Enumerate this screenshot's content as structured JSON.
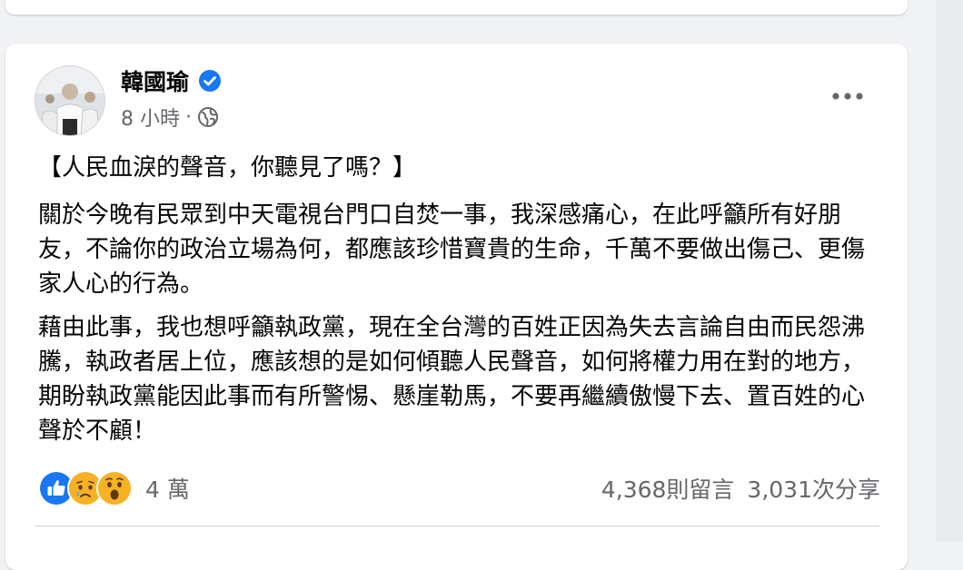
{
  "post": {
    "author": "韓國瑜",
    "time": "8 小時",
    "separator": "·",
    "title": "【人民血淚的聲音，你聽見了嗎？】",
    "paragraphs": [
      "關於今晚有民眾到中天電視台門口自焚一事，我深感痛心，在此呼籲所有好朋友，不論你的政治立場為何，都應該珍惜寶貴的生命，千萬不要做出傷己、更傷家人心的行為。",
      "藉由此事，我也想呼籲執政黨，現在全台灣的百姓正因為失去言論自由而民怨沸騰，執政者居上位，應該想的是如何傾聽人民聲音，如何將權力用在對的地方，期盼執政黨能因此事而有所警惕、懸崖勒馬，不要再繼續傲慢下去、置百姓的心聲於不顧！"
    ],
    "reactions": {
      "icons": [
        "like-icon",
        "sad-icon",
        "wow-icon"
      ],
      "count": "4 萬"
    },
    "comments": "4,368則留言",
    "shares": "3,031次分享"
  },
  "colors": {
    "verified": "#1877f2",
    "like": "#1877f2",
    "emoji": "#f7b125",
    "secondary_text": "#65676b"
  }
}
